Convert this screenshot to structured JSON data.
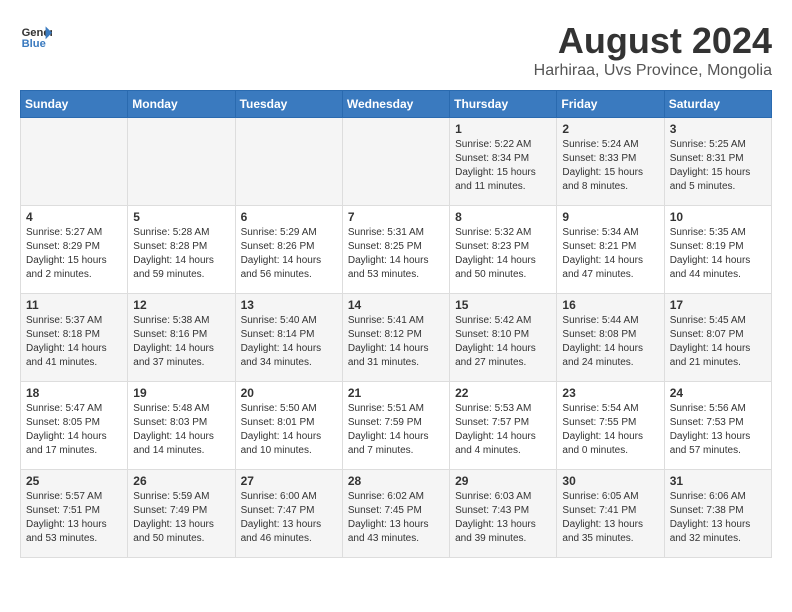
{
  "header": {
    "logo_general": "General",
    "logo_blue": "Blue",
    "month_title": "August 2024",
    "location": "Harhiraa, Uvs Province, Mongolia"
  },
  "days_of_week": [
    "Sunday",
    "Monday",
    "Tuesday",
    "Wednesday",
    "Thursday",
    "Friday",
    "Saturday"
  ],
  "weeks": [
    [
      {
        "day": "",
        "info": ""
      },
      {
        "day": "",
        "info": ""
      },
      {
        "day": "",
        "info": ""
      },
      {
        "day": "",
        "info": ""
      },
      {
        "day": "1",
        "info": "Sunrise: 5:22 AM\nSunset: 8:34 PM\nDaylight: 15 hours\nand 11 minutes."
      },
      {
        "day": "2",
        "info": "Sunrise: 5:24 AM\nSunset: 8:33 PM\nDaylight: 15 hours\nand 8 minutes."
      },
      {
        "day": "3",
        "info": "Sunrise: 5:25 AM\nSunset: 8:31 PM\nDaylight: 15 hours\nand 5 minutes."
      }
    ],
    [
      {
        "day": "4",
        "info": "Sunrise: 5:27 AM\nSunset: 8:29 PM\nDaylight: 15 hours\nand 2 minutes."
      },
      {
        "day": "5",
        "info": "Sunrise: 5:28 AM\nSunset: 8:28 PM\nDaylight: 14 hours\nand 59 minutes."
      },
      {
        "day": "6",
        "info": "Sunrise: 5:29 AM\nSunset: 8:26 PM\nDaylight: 14 hours\nand 56 minutes."
      },
      {
        "day": "7",
        "info": "Sunrise: 5:31 AM\nSunset: 8:25 PM\nDaylight: 14 hours\nand 53 minutes."
      },
      {
        "day": "8",
        "info": "Sunrise: 5:32 AM\nSunset: 8:23 PM\nDaylight: 14 hours\nand 50 minutes."
      },
      {
        "day": "9",
        "info": "Sunrise: 5:34 AM\nSunset: 8:21 PM\nDaylight: 14 hours\nand 47 minutes."
      },
      {
        "day": "10",
        "info": "Sunrise: 5:35 AM\nSunset: 8:19 PM\nDaylight: 14 hours\nand 44 minutes."
      }
    ],
    [
      {
        "day": "11",
        "info": "Sunrise: 5:37 AM\nSunset: 8:18 PM\nDaylight: 14 hours\nand 41 minutes."
      },
      {
        "day": "12",
        "info": "Sunrise: 5:38 AM\nSunset: 8:16 PM\nDaylight: 14 hours\nand 37 minutes."
      },
      {
        "day": "13",
        "info": "Sunrise: 5:40 AM\nSunset: 8:14 PM\nDaylight: 14 hours\nand 34 minutes."
      },
      {
        "day": "14",
        "info": "Sunrise: 5:41 AM\nSunset: 8:12 PM\nDaylight: 14 hours\nand 31 minutes."
      },
      {
        "day": "15",
        "info": "Sunrise: 5:42 AM\nSunset: 8:10 PM\nDaylight: 14 hours\nand 27 minutes."
      },
      {
        "day": "16",
        "info": "Sunrise: 5:44 AM\nSunset: 8:08 PM\nDaylight: 14 hours\nand 24 minutes."
      },
      {
        "day": "17",
        "info": "Sunrise: 5:45 AM\nSunset: 8:07 PM\nDaylight: 14 hours\nand 21 minutes."
      }
    ],
    [
      {
        "day": "18",
        "info": "Sunrise: 5:47 AM\nSunset: 8:05 PM\nDaylight: 14 hours\nand 17 minutes."
      },
      {
        "day": "19",
        "info": "Sunrise: 5:48 AM\nSunset: 8:03 PM\nDaylight: 14 hours\nand 14 minutes."
      },
      {
        "day": "20",
        "info": "Sunrise: 5:50 AM\nSunset: 8:01 PM\nDaylight: 14 hours\nand 10 minutes."
      },
      {
        "day": "21",
        "info": "Sunrise: 5:51 AM\nSunset: 7:59 PM\nDaylight: 14 hours\nand 7 minutes."
      },
      {
        "day": "22",
        "info": "Sunrise: 5:53 AM\nSunset: 7:57 PM\nDaylight: 14 hours\nand 4 minutes."
      },
      {
        "day": "23",
        "info": "Sunrise: 5:54 AM\nSunset: 7:55 PM\nDaylight: 14 hours\nand 0 minutes."
      },
      {
        "day": "24",
        "info": "Sunrise: 5:56 AM\nSunset: 7:53 PM\nDaylight: 13 hours\nand 57 minutes."
      }
    ],
    [
      {
        "day": "25",
        "info": "Sunrise: 5:57 AM\nSunset: 7:51 PM\nDaylight: 13 hours\nand 53 minutes."
      },
      {
        "day": "26",
        "info": "Sunrise: 5:59 AM\nSunset: 7:49 PM\nDaylight: 13 hours\nand 50 minutes."
      },
      {
        "day": "27",
        "info": "Sunrise: 6:00 AM\nSunset: 7:47 PM\nDaylight: 13 hours\nand 46 minutes."
      },
      {
        "day": "28",
        "info": "Sunrise: 6:02 AM\nSunset: 7:45 PM\nDaylight: 13 hours\nand 43 minutes."
      },
      {
        "day": "29",
        "info": "Sunrise: 6:03 AM\nSunset: 7:43 PM\nDaylight: 13 hours\nand 39 minutes."
      },
      {
        "day": "30",
        "info": "Sunrise: 6:05 AM\nSunset: 7:41 PM\nDaylight: 13 hours\nand 35 minutes."
      },
      {
        "day": "31",
        "info": "Sunrise: 6:06 AM\nSunset: 7:38 PM\nDaylight: 13 hours\nand 32 minutes."
      }
    ]
  ]
}
